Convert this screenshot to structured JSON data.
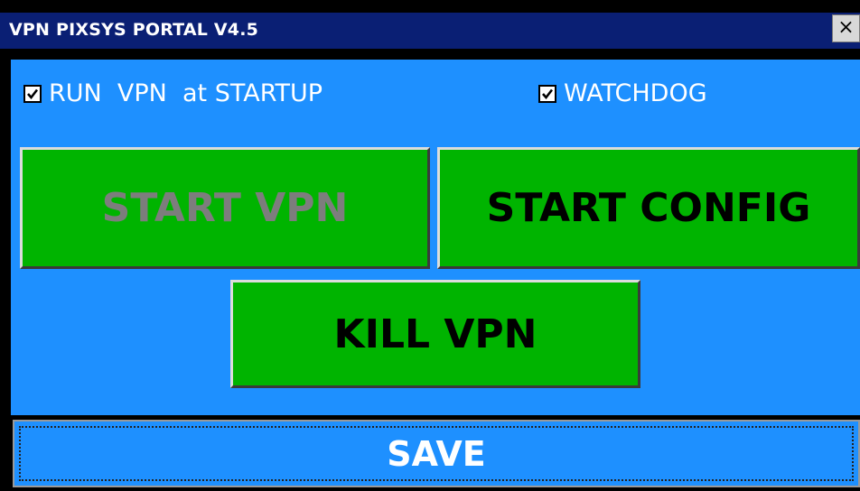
{
  "window": {
    "title": "VPN PIXSYS PORTAL  V4.5",
    "close_glyph": "×"
  },
  "options": {
    "run_at_startup": {
      "label": "RUN  VPN  at STARTUP",
      "checked": true
    },
    "watchdog": {
      "label": "WATCHDOG",
      "checked": true
    }
  },
  "buttons": {
    "start_vpn": {
      "label": "START VPN",
      "enabled": false
    },
    "start_config": {
      "label": "START CONFIG",
      "enabled": true
    },
    "kill_vpn": {
      "label": "KILL VPN",
      "enabled": true
    },
    "save": {
      "label": "SAVE"
    }
  },
  "colors": {
    "panel_bg": "#1e90ff",
    "titlebar_bg": "#0a1f74",
    "button_green": "#00b400",
    "disabled_text": "#7d7d7d"
  },
  "icons": {
    "checkbox": "check-mark-icon",
    "close": "close-icon"
  }
}
